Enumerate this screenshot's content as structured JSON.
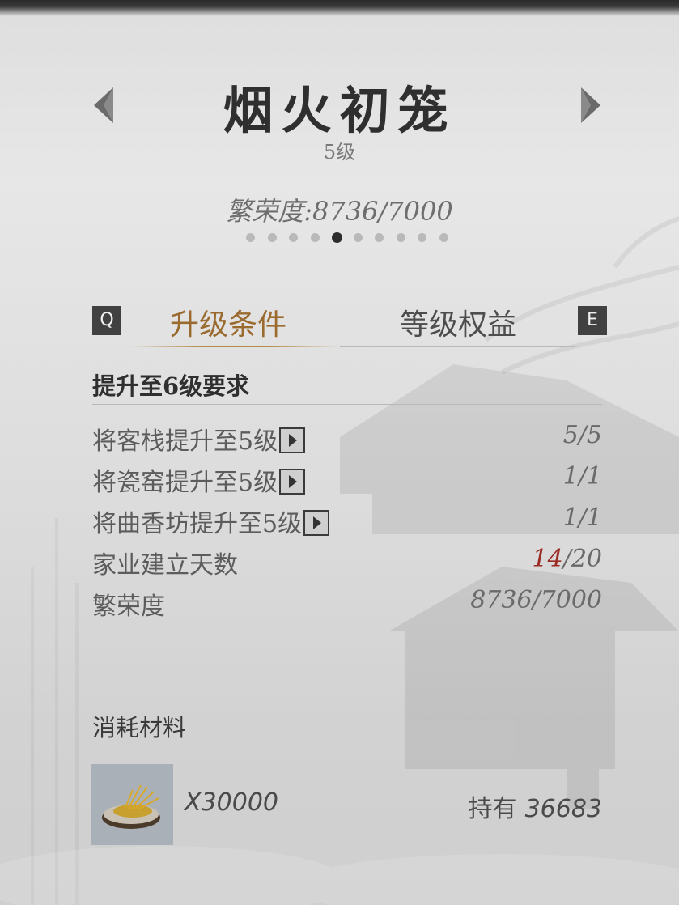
{
  "header": {
    "title": "烟火初笼",
    "level": "5级",
    "prosperity": "繁荣度:8736/7000",
    "page_dots": {
      "count": 10,
      "active_index": 4
    }
  },
  "tabs": {
    "prev_key": "Q",
    "next_key": "E",
    "items": [
      {
        "label": "升级条件",
        "active": true
      },
      {
        "label": "等级权益",
        "active": false
      }
    ]
  },
  "requirements": {
    "heading": "提升至6级要求",
    "rows": [
      {
        "label": "将客栈提升至5级",
        "has_go_button": true,
        "value": "5/5"
      },
      {
        "label": "将瓷窑提升至5级",
        "has_go_button": true,
        "value": "1/1"
      },
      {
        "label": "将曲香坊提升至5级",
        "has_go_button": true,
        "value": "1/1"
      },
      {
        "label": "家业建立天数",
        "has_go_button": false,
        "value_current": "14",
        "value_total": "/20",
        "current_color": "#9b2b25"
      },
      {
        "label": "繁荣度",
        "has_go_button": false,
        "value": "8736/7000"
      }
    ]
  },
  "materials": {
    "heading": "消耗材料",
    "item": {
      "icon": "grain-bowl-icon",
      "count": "X30000",
      "owned_label": "持有",
      "owned_value": "36683"
    }
  },
  "colors": {
    "accent_gold": "#9a6a2e",
    "text_dark": "#2f2f2f",
    "warning_red": "#9b2b25"
  }
}
